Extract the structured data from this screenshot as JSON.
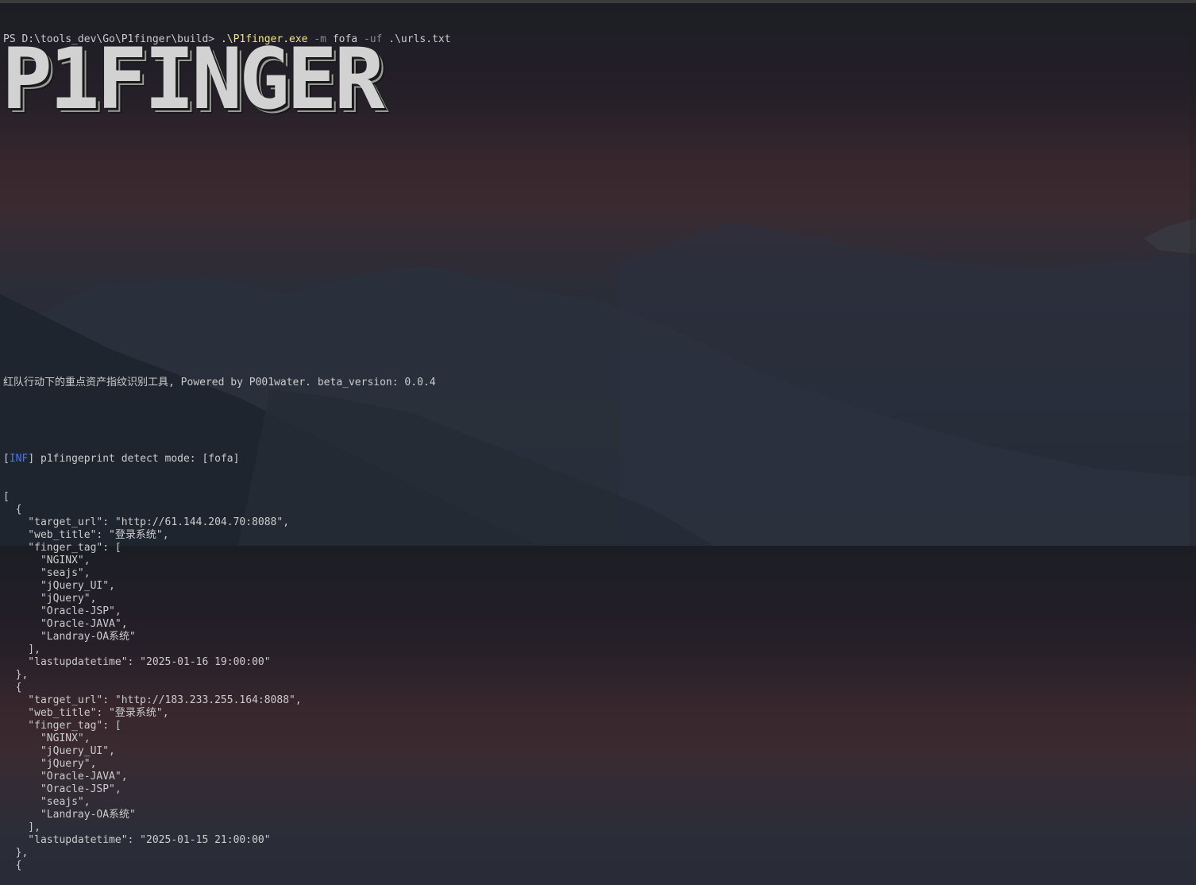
{
  "prompt": {
    "path": "PS D:\\tools_dev\\Go\\P1finger\\build> ",
    "exe": ".\\P1finger.exe",
    "args": [
      {
        "text": " -m",
        "style": "flag"
      },
      {
        "text": " fofa",
        "style": "plain"
      },
      {
        "text": " -uf",
        "style": "flag"
      },
      {
        "text": " .\\urls.txt",
        "style": "plain"
      }
    ]
  },
  "banner": "P1FINGER",
  "subtitle": "红队行动下的重点资产指纹识别工具, Powered by P001water. beta_version: 0.0.4",
  "info": {
    "bracket_open": "[",
    "tag": "INF",
    "bracket_close": "]",
    "message": " p1fingeprint detect mode: [fofa]"
  },
  "output_lines": [
    "[",
    "  {",
    "    \"target_url\": \"http://61.144.204.70:8088\",",
    "    \"web_title\": \"登录系统\",",
    "    \"finger_tag\": [",
    "      \"NGINX\",",
    "      \"seajs\",",
    "      \"jQuery_UI\",",
    "      \"jQuery\",",
    "      \"Oracle-JSP\",",
    "      \"Oracle-JAVA\",",
    "      \"Landray-OA系统\"",
    "    ],",
    "    \"lastupdatetime\": \"2025-01-16 19:00:00\"",
    "  },",
    "  {",
    "    \"target_url\": \"http://183.233.255.164:8088\",",
    "    \"web_title\": \"登录系统\",",
    "    \"finger_tag\": [",
    "      \"NGINX\",",
    "      \"jQuery_UI\",",
    "      \"jQuery\",",
    "      \"Oracle-JAVA\",",
    "      \"Oracle-JSP\",",
    "      \"seajs\",",
    "      \"Landray-OA系统\"",
    "    ],",
    "    \"lastupdatetime\": \"2025-01-15 21:00:00\"",
    "  },",
    "  {"
  ],
  "colors": {
    "command": "#f0e68c",
    "flag": "#8a8a8a",
    "inf_tag": "#3b78ff",
    "text": "#cccccc"
  }
}
